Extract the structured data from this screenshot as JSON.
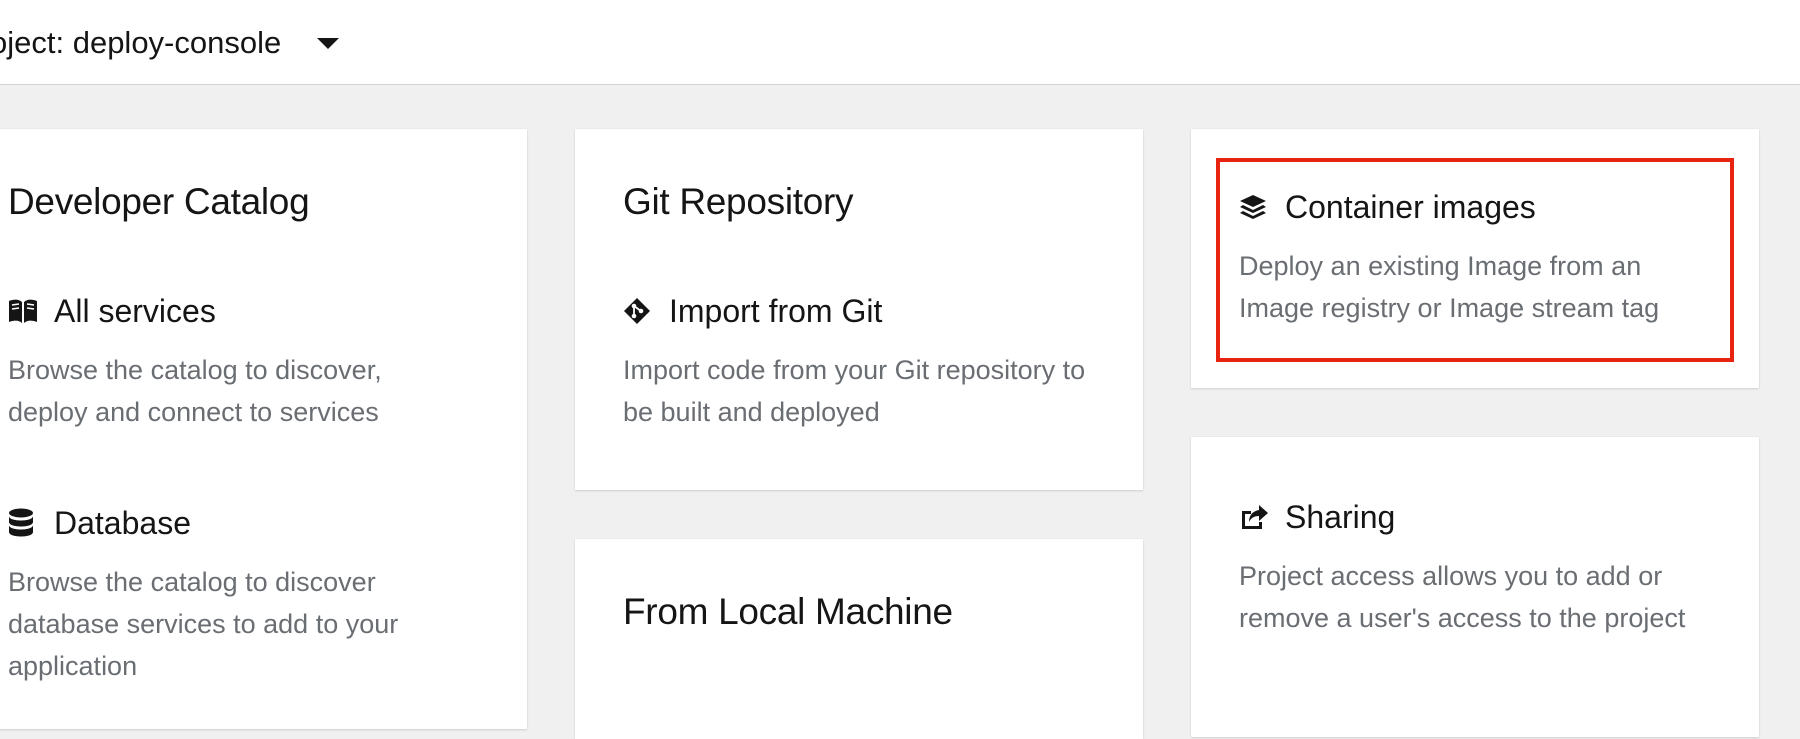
{
  "header": {
    "project_label": "oject: deploy-console",
    "dropdown_icon": "caret-down-icon"
  },
  "cards": {
    "developer_catalog": {
      "title": "Developer Catalog",
      "items": [
        {
          "icon": "book-icon",
          "label": "All services",
          "description": "Browse the catalog to discover, deploy and connect to services"
        },
        {
          "icon": "database-icon",
          "label": "Database",
          "description": "Browse the catalog to discover database services to add to your application"
        }
      ]
    },
    "git_repository": {
      "title": "Git Repository",
      "items": [
        {
          "icon": "git-icon",
          "label": "Import from Git",
          "description": "Import code from your Git repository to be built and deployed"
        }
      ]
    },
    "local_machine": {
      "title": "From Local Machine"
    },
    "container_images": {
      "icon": "layer-group-icon",
      "label": "Container images",
      "description": "Deploy an existing Image from an Image registry or Image stream tag"
    },
    "sharing": {
      "icon": "share-icon",
      "label": "Sharing",
      "description": "Project access allows you to add or remove a user's access to the project"
    }
  },
  "colors": {
    "highlight_border": "#e8230f",
    "background": "#f0f0f0",
    "card": "#ffffff",
    "description_text": "#6a6e73"
  }
}
